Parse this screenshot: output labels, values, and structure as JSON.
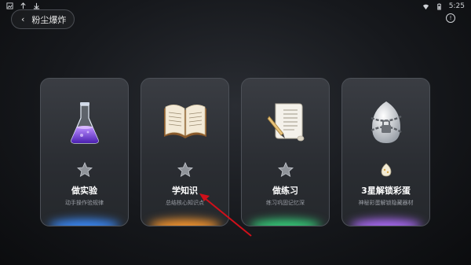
{
  "status_bar": {
    "time": "5:25",
    "left_icons": [
      "image-icon",
      "signal-icon",
      "download-icon"
    ],
    "right_icons": [
      "wifi-icon",
      "battery-icon"
    ]
  },
  "header": {
    "back_icon": "chevron-left-icon",
    "title": "粉尘爆炸",
    "info_icon": "info-icon"
  },
  "cards": [
    {
      "title": "做实验",
      "subtitle": "动手操作验规律",
      "icon": "flask-icon",
      "badge": "star-icon",
      "glow": "#3a8cff"
    },
    {
      "title": "学知识",
      "subtitle": "总结核心知识点",
      "icon": "book-icon",
      "badge": "star-icon",
      "glow": "#ff9a2e"
    },
    {
      "title": "做练习",
      "subtitle": "练习巩固记忆深",
      "icon": "scroll-quill-icon",
      "badge": "star-icon",
      "glow": "#35d07a"
    },
    {
      "title": "3星解锁彩蛋",
      "subtitle": "神秘彩蛋解锁隐藏器材",
      "icon": "locked-egg-icon",
      "badge": "egg-icon",
      "glow": "#b06cff"
    }
  ],
  "annotation": {
    "arrow_color": "#d0101a"
  }
}
